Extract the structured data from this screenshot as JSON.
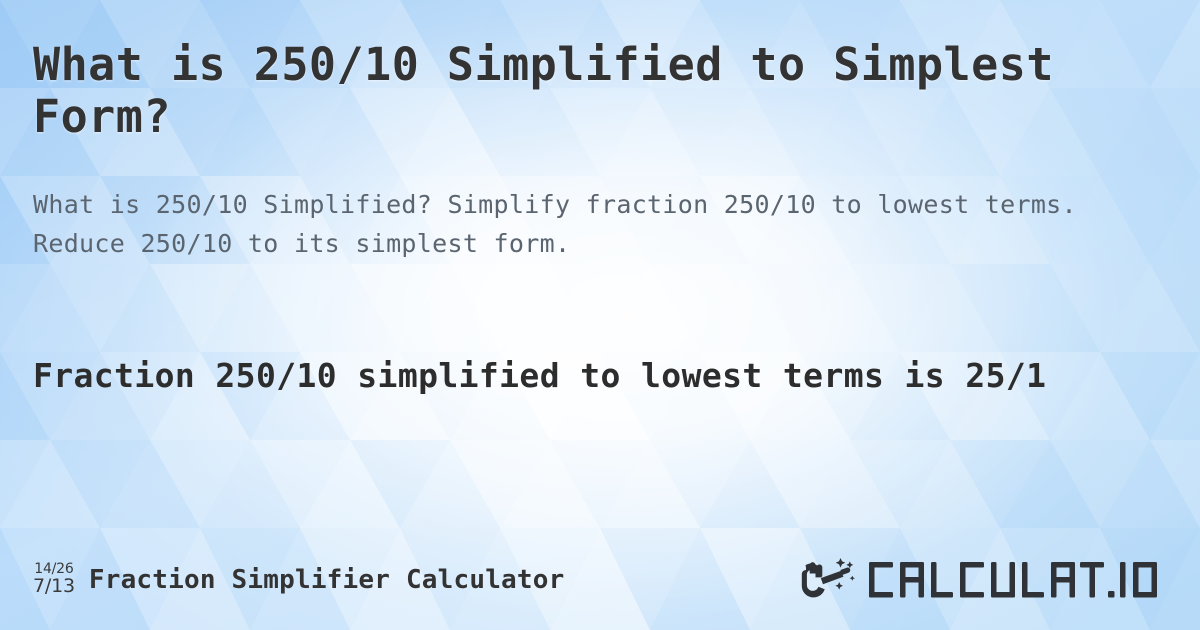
{
  "page": {
    "title": "What is 250/10 Simplified to Simplest Form?",
    "subtitle": "What is 250/10 Simplified? Simplify fraction 250/10 to lowest terms. Reduce 250/10 to its simplest form.",
    "result": "Fraction 250/10 simplified to lowest terms is 25/1"
  },
  "fraction": {
    "numerator": "250",
    "denominator": "10",
    "simplified": "25/1",
    "original": "250/10"
  },
  "footer": {
    "icon_top": "14/26",
    "icon_bottom": "7/13",
    "site_name": "Fraction Simplifier Calculator",
    "logo_text": "CALCULAT.IO",
    "logo_icon": "magic-wand-hand-icon"
  },
  "colors": {
    "background_blue": "#a9d2f7",
    "background_light": "#eaf4fd",
    "title_text": "#333333",
    "subtitle_text": "#5b6570",
    "result_text": "#2d2d2d",
    "logo_dark": "#2f3338"
  }
}
